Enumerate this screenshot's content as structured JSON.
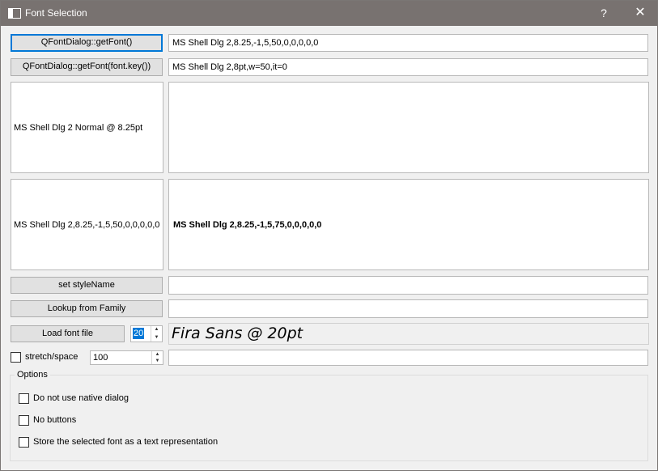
{
  "window": {
    "title": "Font Selection",
    "help_label": "?",
    "close_label": "✕"
  },
  "rows": {
    "get_font_button": "QFontDialog::getFont()",
    "get_font_value": "MS Shell Dlg 2,8.25,-1,5,50,0,0,0,0,0",
    "get_font_key_button": "QFontDialog::getFont(font.key())",
    "get_font_key_value": "MS Shell Dlg 2,8pt,w=50,it=0",
    "panel1_left": "MS Shell Dlg 2 Normal @ 8.25pt",
    "panel1_right": "",
    "panel2_left": "MS Shell Dlg 2,8.25,-1,5,50,0,0,0,0,0",
    "panel2_right": "MS Shell Dlg 2,8.25,-1,5,75,0,0,0,0,0",
    "set_style_button": "set styleName",
    "set_style_value": "",
    "lookup_family_button": "Lookup from Family",
    "lookup_family_value": "",
    "load_font_button": "Load font file",
    "load_font_size": "20",
    "font_preview": "Fira Sans  @ 20pt",
    "stretch_label": "stretch/space",
    "stretch_value": "100",
    "stretch_result": ""
  },
  "options": {
    "title": "Options",
    "no_native": "Do not use native dialog",
    "no_buttons": "No buttons",
    "store_text": "Store the selected font as a text representation"
  },
  "icons": {
    "app": "window-icon",
    "spin_up": "▲",
    "spin_down": "▼"
  },
  "colors": {
    "titlebar": "#787270",
    "focus": "#0078d7",
    "background": "#f0f0f0"
  }
}
